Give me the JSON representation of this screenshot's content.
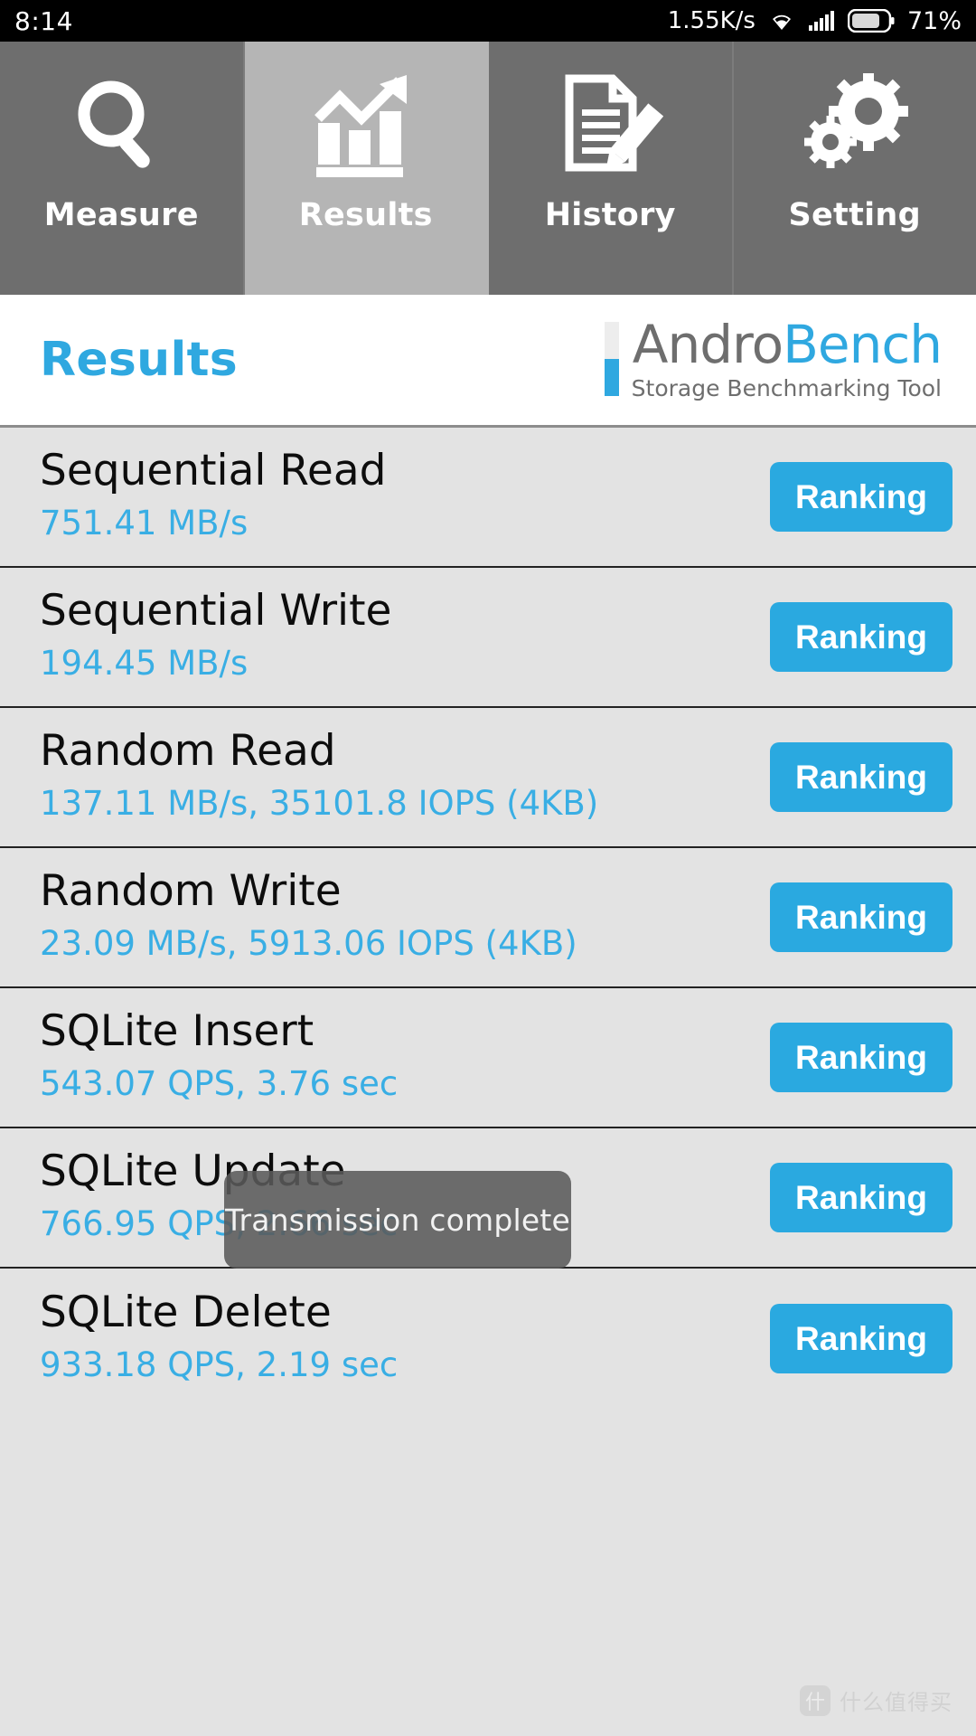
{
  "status_bar": {
    "time": "8:14",
    "network_speed": "1.55K/s",
    "wifi_icon": "wifi-icon",
    "signal_icon": "signal-bars-icon",
    "battery_icon": "battery-icon",
    "battery_percent": "71%"
  },
  "tabs": [
    {
      "label": "Measure",
      "icon": "magnifier-icon",
      "active": false
    },
    {
      "label": "Results",
      "icon": "bar-chart-arrow-icon",
      "active": true
    },
    {
      "label": "History",
      "icon": "document-pencil-icon",
      "active": false
    },
    {
      "label": "Setting",
      "icon": "gears-icon",
      "active": false
    }
  ],
  "header": {
    "title": "Results",
    "brand_part1": "Andro",
    "brand_part2": "Bench",
    "brand_subtitle": "Storage Benchmarking Tool"
  },
  "results": [
    {
      "title": "Sequential Read",
      "value": "751.41 MB/s",
      "button": "Ranking"
    },
    {
      "title": "Sequential Write",
      "value": "194.45 MB/s",
      "button": "Ranking"
    },
    {
      "title": "Random Read",
      "value": "137.11 MB/s, 35101.8 IOPS (4KB)",
      "button": "Ranking"
    },
    {
      "title": "Random Write",
      "value": "23.09 MB/s, 5913.06 IOPS (4KB)",
      "button": "Ranking"
    },
    {
      "title": "SQLite Insert",
      "value": "543.07 QPS, 3.76 sec",
      "button": "Ranking"
    },
    {
      "title": "SQLite Update",
      "value": "766.95 QPS, 2.66 sec",
      "button": "Ranking"
    },
    {
      "title": "SQLite Delete",
      "value": "933.18 QPS, 2.19 sec",
      "button": "Ranking"
    }
  ],
  "toast": {
    "message": "Transmission complete"
  },
  "watermark": {
    "badge": "什",
    "text": "什么值得买"
  },
  "colors": {
    "accent_blue": "#2aa9e0",
    "value_blue": "#39aee4",
    "tab_inactive": "#6e6e6e",
    "tab_active": "#b5b5b5",
    "list_bg": "#e3e3e3"
  }
}
